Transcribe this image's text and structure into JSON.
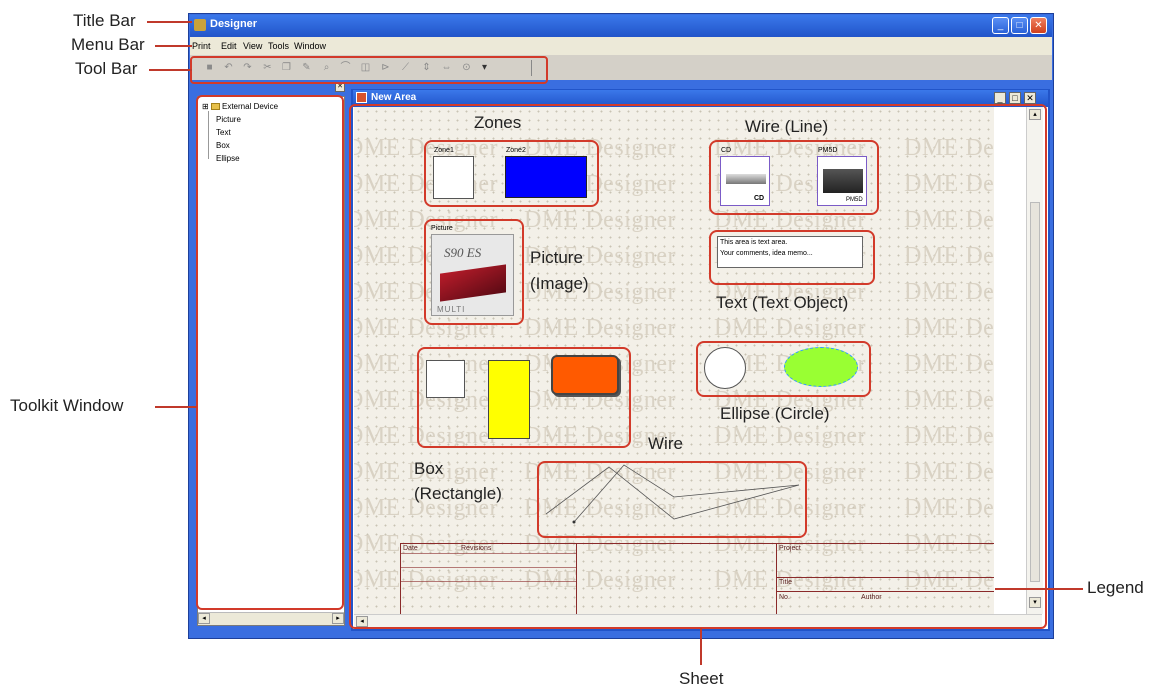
{
  "app": {
    "title": "Designer",
    "menu": [
      "Print",
      "Edit",
      "View",
      "Tools",
      "Window"
    ],
    "document_title": "New Area",
    "watermark": "DME Designer"
  },
  "toolkit": {
    "tree": [
      "External Device",
      "Picture",
      "Text",
      "Box",
      "Ellipse"
    ]
  },
  "sheet": {
    "zones": [
      "Zone1",
      "Zone2"
    ],
    "devices": [
      "CD",
      "PM5D"
    ],
    "device_badges": [
      "CD",
      "PM5D"
    ],
    "picture_label": "Picture",
    "picture_brand": "S90 ES",
    "picture_sub": "MULTI",
    "text_area": [
      "This area is text area.",
      "Your comments, idea memo..."
    ],
    "legend": {
      "date": "Date",
      "revisions": "Revisions",
      "project": "Project",
      "title": "Title",
      "no": "No.",
      "author": "Author"
    }
  },
  "callouts": {
    "title_bar": "Title Bar",
    "menu_bar": "Menu Bar",
    "tool_bar": "Tool Bar",
    "toolkit_window": "Toolkit Window",
    "legend": "Legend",
    "sheet": "Sheet"
  },
  "annotations": {
    "zones": "Zones",
    "wire_line": "Wire (Line)",
    "picture": "Picture",
    "picture_sub": "(Image)",
    "text_object": "Text (Text Object)",
    "ellipse": "Ellipse (Circle)",
    "wire": "Wire",
    "box": "Box",
    "box_sub": "(Rectangle)"
  },
  "colors": {
    "window_blue": "#3a6ee0",
    "annotation_red": "#d23a2a",
    "zone2_fill": "#0000ff",
    "box_yellow": "#ffff00",
    "box_orange": "#ff5a00",
    "ellipse_green": "#99ff33"
  }
}
